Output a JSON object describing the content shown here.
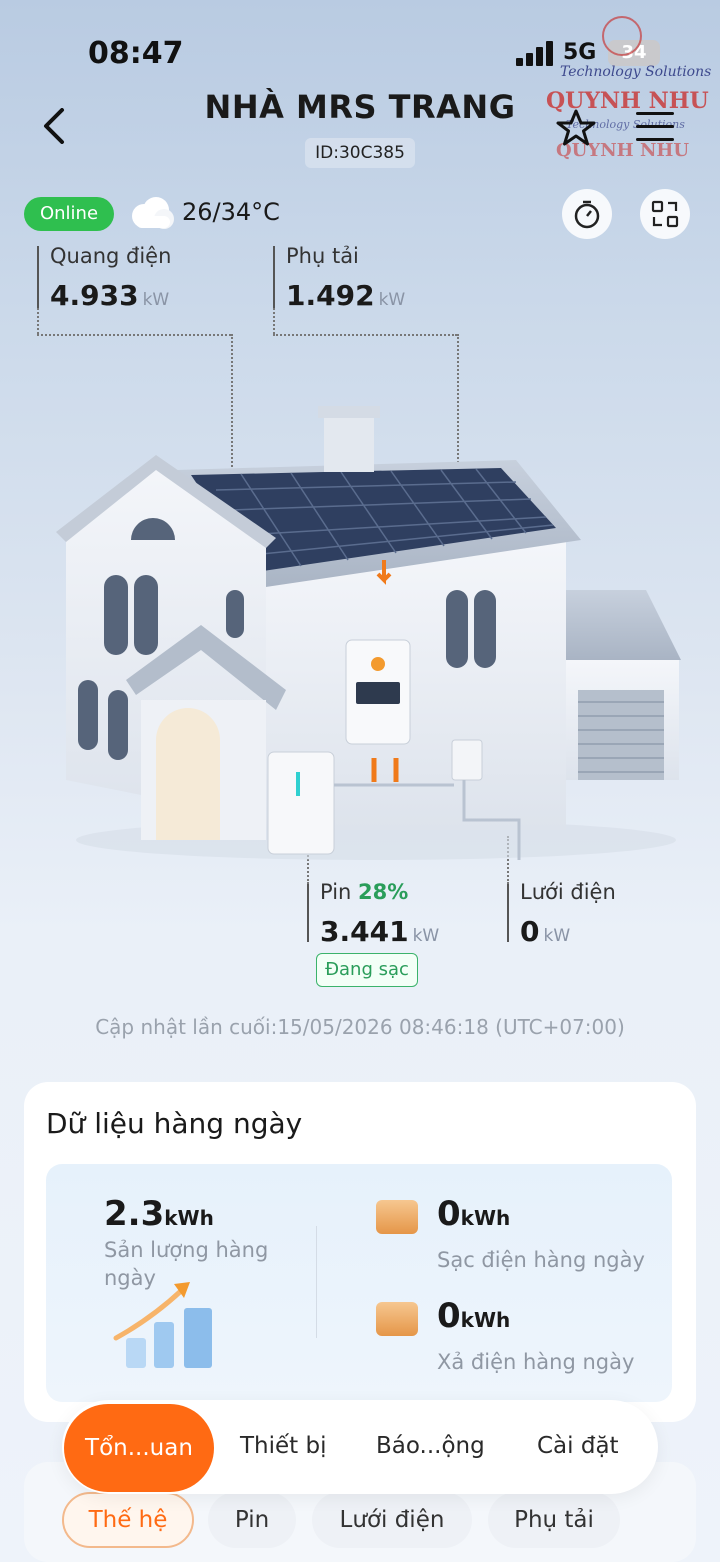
{
  "status_bar": {
    "time": "08:47",
    "network": "5G",
    "battery": "34"
  },
  "watermark": {
    "line1": "Technology Solutions",
    "line2": "QUYNH NHU",
    "line3": "Technology Solutions",
    "line4": "QUYNH NHU"
  },
  "header": {
    "title": "NHÀ MRS TRANG",
    "plant_id": "ID:30C385"
  },
  "status": {
    "online_label": "Online",
    "weather_icon": "cloud-icon",
    "temperature": "26/34°C"
  },
  "metrics": {
    "pv": {
      "label": "Quang điện",
      "value": "4.933",
      "unit": "kW"
    },
    "load": {
      "label": "Phụ tải",
      "value": "1.492",
      "unit": "kW"
    },
    "battery": {
      "label": "Pin",
      "percent": "28%",
      "value": "3.441",
      "unit": "kW",
      "state": "Đang sạc"
    },
    "grid": {
      "label": "Lưới điện",
      "value": "0",
      "unit": "kW"
    }
  },
  "last_updated": "Cập nhật lần cuối:15/05/2026 08:46:18 (UTC+07:00)",
  "daily": {
    "title": "Dữ liệu hàng ngày",
    "production": {
      "value": "2.3",
      "unit": "kWh",
      "label": "Sản lượng hàng ngày"
    },
    "charge": {
      "value": "0",
      "unit": "kWh",
      "label": "Sạc điện hàng ngày"
    },
    "discharge": {
      "value": "0",
      "unit": "kWh",
      "label": "Xả điện hàng ngày"
    }
  },
  "nav": {
    "items": [
      "Tổn...uan",
      "Thiết bị",
      "Báo...ộng",
      "Cài đặt"
    ],
    "active": "Tổn...uan"
  },
  "subtabs": {
    "items": [
      "Thế hệ",
      "Pin",
      "Lưới điện",
      "Phụ tải"
    ],
    "active": "Thế hệ"
  },
  "colors": {
    "accent": "#ff6a13",
    "online": "#2fbf4f",
    "charge_green": "#2a9d5a"
  }
}
